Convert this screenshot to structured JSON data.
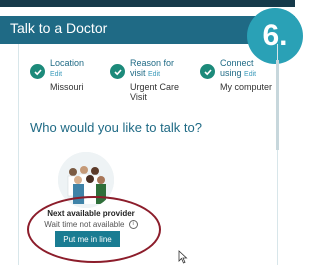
{
  "header": {
    "title": "Talk to a Doctor",
    "step_number": "6."
  },
  "steps": [
    {
      "title_line1": "Location",
      "edit_label": "Edit",
      "title_line2": "",
      "value": "Missouri"
    },
    {
      "title_line1": "Reason for",
      "title_line2": "visit",
      "edit_label": "Edit",
      "value": "Urgent Care Visit"
    },
    {
      "title_line1": "Connect",
      "title_line2": "using",
      "edit_label": "Edit",
      "value": "My computer"
    }
  ],
  "question": "Who would you like to talk to?",
  "provider": {
    "next_label": "Next available provider",
    "wait_text": "Wait time not available",
    "button_label": "Put me in line"
  },
  "icons": {
    "check": "check-circle-icon",
    "info": "info-icon",
    "cursor": "mouse-cursor-icon"
  },
  "colors": {
    "header_bg": "#1f6a85",
    "badge_bg": "#2aa1b6",
    "accent_teal": "#1c8a7a",
    "button_bg": "#1a7c92",
    "highlight_oval": "#8c1d2b"
  }
}
